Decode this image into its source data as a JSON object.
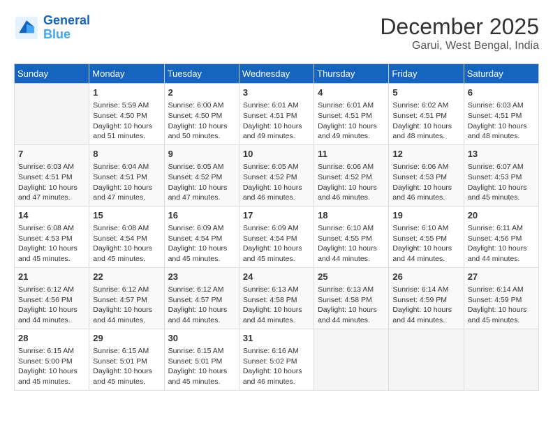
{
  "logo": {
    "line1": "General",
    "line2": "Blue"
  },
  "title": "December 2025",
  "subtitle": "Garui, West Bengal, India",
  "days_of_week": [
    "Sunday",
    "Monday",
    "Tuesday",
    "Wednesday",
    "Thursday",
    "Friday",
    "Saturday"
  ],
  "weeks": [
    [
      {
        "day": "",
        "info": ""
      },
      {
        "day": "1",
        "info": "Sunrise: 5:59 AM\nSunset: 4:50 PM\nDaylight: 10 hours and 51 minutes."
      },
      {
        "day": "2",
        "info": "Sunrise: 6:00 AM\nSunset: 4:50 PM\nDaylight: 10 hours and 50 minutes."
      },
      {
        "day": "3",
        "info": "Sunrise: 6:01 AM\nSunset: 4:51 PM\nDaylight: 10 hours and 49 minutes."
      },
      {
        "day": "4",
        "info": "Sunrise: 6:01 AM\nSunset: 4:51 PM\nDaylight: 10 hours and 49 minutes."
      },
      {
        "day": "5",
        "info": "Sunrise: 6:02 AM\nSunset: 4:51 PM\nDaylight: 10 hours and 48 minutes."
      },
      {
        "day": "6",
        "info": "Sunrise: 6:03 AM\nSunset: 4:51 PM\nDaylight: 10 hours and 48 minutes."
      }
    ],
    [
      {
        "day": "7",
        "info": "Sunrise: 6:03 AM\nSunset: 4:51 PM\nDaylight: 10 hours and 47 minutes."
      },
      {
        "day": "8",
        "info": "Sunrise: 6:04 AM\nSunset: 4:51 PM\nDaylight: 10 hours and 47 minutes."
      },
      {
        "day": "9",
        "info": "Sunrise: 6:05 AM\nSunset: 4:52 PM\nDaylight: 10 hours and 47 minutes."
      },
      {
        "day": "10",
        "info": "Sunrise: 6:05 AM\nSunset: 4:52 PM\nDaylight: 10 hours and 46 minutes."
      },
      {
        "day": "11",
        "info": "Sunrise: 6:06 AM\nSunset: 4:52 PM\nDaylight: 10 hours and 46 minutes."
      },
      {
        "day": "12",
        "info": "Sunrise: 6:06 AM\nSunset: 4:53 PM\nDaylight: 10 hours and 46 minutes."
      },
      {
        "day": "13",
        "info": "Sunrise: 6:07 AM\nSunset: 4:53 PM\nDaylight: 10 hours and 45 minutes."
      }
    ],
    [
      {
        "day": "14",
        "info": "Sunrise: 6:08 AM\nSunset: 4:53 PM\nDaylight: 10 hours and 45 minutes."
      },
      {
        "day": "15",
        "info": "Sunrise: 6:08 AM\nSunset: 4:54 PM\nDaylight: 10 hours and 45 minutes."
      },
      {
        "day": "16",
        "info": "Sunrise: 6:09 AM\nSunset: 4:54 PM\nDaylight: 10 hours and 45 minutes."
      },
      {
        "day": "17",
        "info": "Sunrise: 6:09 AM\nSunset: 4:54 PM\nDaylight: 10 hours and 45 minutes."
      },
      {
        "day": "18",
        "info": "Sunrise: 6:10 AM\nSunset: 4:55 PM\nDaylight: 10 hours and 44 minutes."
      },
      {
        "day": "19",
        "info": "Sunrise: 6:10 AM\nSunset: 4:55 PM\nDaylight: 10 hours and 44 minutes."
      },
      {
        "day": "20",
        "info": "Sunrise: 6:11 AM\nSunset: 4:56 PM\nDaylight: 10 hours and 44 minutes."
      }
    ],
    [
      {
        "day": "21",
        "info": "Sunrise: 6:12 AM\nSunset: 4:56 PM\nDaylight: 10 hours and 44 minutes."
      },
      {
        "day": "22",
        "info": "Sunrise: 6:12 AM\nSunset: 4:57 PM\nDaylight: 10 hours and 44 minutes."
      },
      {
        "day": "23",
        "info": "Sunrise: 6:12 AM\nSunset: 4:57 PM\nDaylight: 10 hours and 44 minutes."
      },
      {
        "day": "24",
        "info": "Sunrise: 6:13 AM\nSunset: 4:58 PM\nDaylight: 10 hours and 44 minutes."
      },
      {
        "day": "25",
        "info": "Sunrise: 6:13 AM\nSunset: 4:58 PM\nDaylight: 10 hours and 44 minutes."
      },
      {
        "day": "26",
        "info": "Sunrise: 6:14 AM\nSunset: 4:59 PM\nDaylight: 10 hours and 44 minutes."
      },
      {
        "day": "27",
        "info": "Sunrise: 6:14 AM\nSunset: 4:59 PM\nDaylight: 10 hours and 45 minutes."
      }
    ],
    [
      {
        "day": "28",
        "info": "Sunrise: 6:15 AM\nSunset: 5:00 PM\nDaylight: 10 hours and 45 minutes."
      },
      {
        "day": "29",
        "info": "Sunrise: 6:15 AM\nSunset: 5:01 PM\nDaylight: 10 hours and 45 minutes."
      },
      {
        "day": "30",
        "info": "Sunrise: 6:15 AM\nSunset: 5:01 PM\nDaylight: 10 hours and 45 minutes."
      },
      {
        "day": "31",
        "info": "Sunrise: 6:16 AM\nSunset: 5:02 PM\nDaylight: 10 hours and 46 minutes."
      },
      {
        "day": "",
        "info": ""
      },
      {
        "day": "",
        "info": ""
      },
      {
        "day": "",
        "info": ""
      }
    ]
  ]
}
